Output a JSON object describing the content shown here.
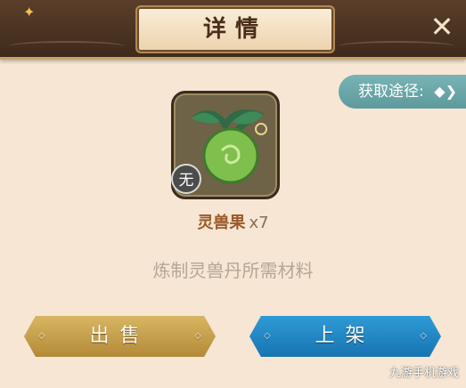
{
  "header": {
    "title": "详情"
  },
  "close_icon": "close-icon",
  "source_button": {
    "label": "获取途径:",
    "icon": "double-arrow-icon"
  },
  "item": {
    "icon": "green-fruit-icon",
    "grade": "无",
    "name": "灵兽果",
    "count": "x7",
    "description": "炼制灵兽丹所需材料"
  },
  "actions": {
    "sell": "出售",
    "list": "上架"
  },
  "watermark": "九游手机游戏",
  "colors": {
    "header": "#3f2a1b",
    "background": "#f6e6d3",
    "sell": "#c9a24d",
    "list": "#1f85c4",
    "source": "#6aa6a8"
  }
}
